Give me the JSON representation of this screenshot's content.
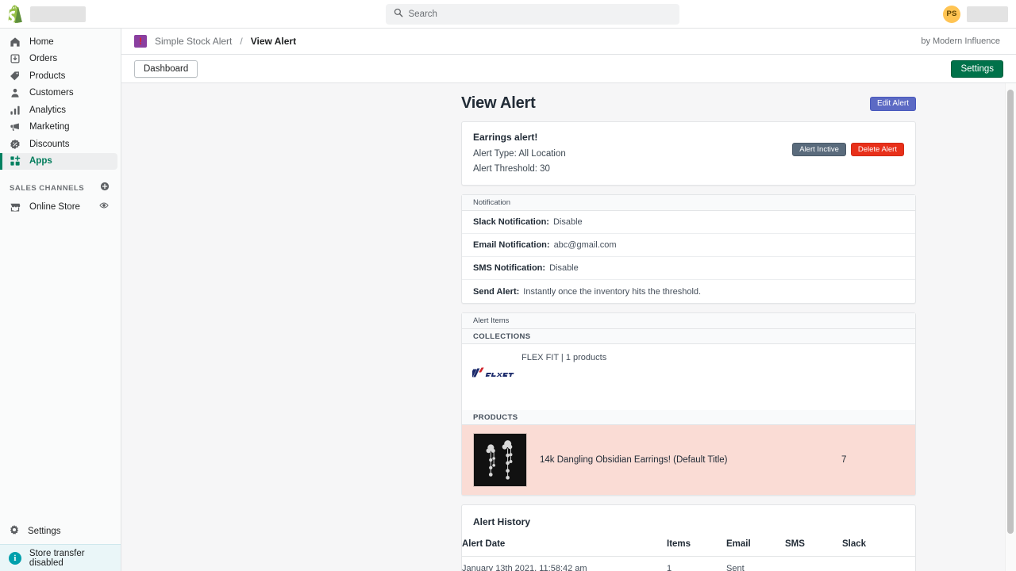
{
  "topbar": {
    "logo_icon": "shopify-bag-icon",
    "store_name_redacted": "",
    "search": {
      "icon": "search-icon",
      "placeholder": "Search",
      "value": ""
    },
    "avatar_initials": "PS",
    "user_name_redacted": ""
  },
  "sidebar": {
    "items": [
      {
        "label": "Home",
        "icon": "home-icon",
        "active": false
      },
      {
        "label": "Orders",
        "icon": "orders-icon",
        "active": false
      },
      {
        "label": "Products",
        "icon": "tag-icon",
        "active": false
      },
      {
        "label": "Customers",
        "icon": "person-icon",
        "active": false
      },
      {
        "label": "Analytics",
        "icon": "bar-chart-icon",
        "active": false
      },
      {
        "label": "Marketing",
        "icon": "megaphone-icon",
        "active": false
      },
      {
        "label": "Discounts",
        "icon": "discount-icon",
        "active": false
      },
      {
        "label": "Apps",
        "icon": "apps-grid-icon",
        "active": true
      }
    ],
    "sales_channels": {
      "label": "SALES CHANNELS",
      "add_icon": "plus-circle-icon",
      "items": [
        {
          "label": "Online Store",
          "icon": "storefront-icon",
          "trailing_icon": "eye-icon"
        }
      ]
    },
    "settings": {
      "label": "Settings",
      "icon": "gear-icon"
    },
    "store_banner": {
      "label": "Store transfer disabled",
      "icon": "info-circle-icon"
    },
    "accent_color": "#008060"
  },
  "app_header": {
    "app_icon": "alert-exclamation-icon",
    "app_name": "Simple Stock Alert",
    "separator": "/",
    "current_page": "View Alert",
    "byline": "by Modern Influence"
  },
  "app_subbar": {
    "dashboard_label": "Dashboard",
    "settings_label": "Settings",
    "settings_color": "#00724a"
  },
  "main": {
    "page_title": "View Alert",
    "edit_button": {
      "label": "Edit Alert",
      "color": "#5c6ac4"
    },
    "alert": {
      "name": "Earrings alert!",
      "type_line": "Alert Type: All Location",
      "threshold_line": "Alert Threshold: 30",
      "status_button": {
        "label": "Alert Inctive",
        "color": "#5a6b7c"
      },
      "delete_button": {
        "label": "Delete Alert",
        "color": "#e8301a"
      }
    },
    "notification": {
      "section_title": "Notification",
      "rows": [
        {
          "key": "Slack Notification:",
          "value": "Disable"
        },
        {
          "key": "Email Notification:",
          "value": "abc@gmail.com"
        },
        {
          "key": "SMS Notification:",
          "value": "Disable"
        },
        {
          "key": "Send Alert:",
          "value": "Instantly once the inventory hits the threshold."
        }
      ]
    },
    "alert_items": {
      "section_title": "Alert Items",
      "collections_header": "COLLECTIONS",
      "collection": {
        "label": "FLEX FIT | 1 products",
        "logo": "flexfit-logo"
      },
      "products_header": "PRODUCTS",
      "product": {
        "thumbnail": "earrings-thumbnail",
        "name": "14k Dangling Obsidian Earrings! (Default Title)",
        "quantity": "7",
        "row_color": "#fadcd5"
      }
    },
    "alert_history": {
      "title": "Alert History",
      "columns": [
        "Alert Date",
        "Items",
        "Email",
        "SMS",
        "Slack"
      ],
      "rows": [
        {
          "date": "January 13th 2021, 11:58:42 am",
          "items": "1",
          "email": "Sent",
          "sms": "",
          "slack": ""
        }
      ]
    }
  }
}
